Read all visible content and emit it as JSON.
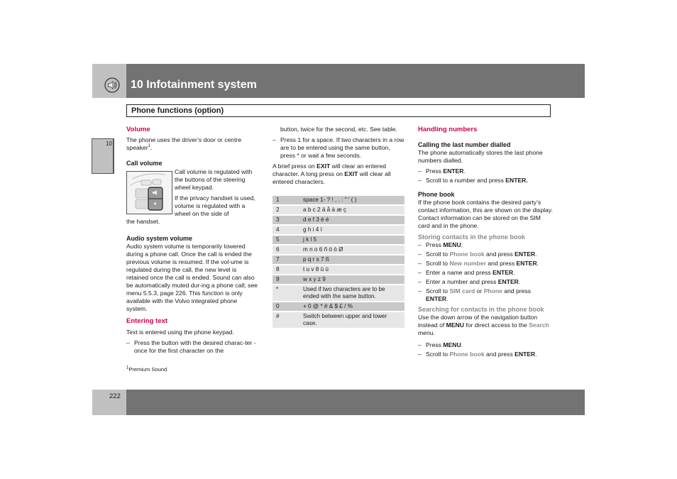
{
  "header": {
    "chapter_title": "10 Infotainment system",
    "chapter_icon": "speaker-icon",
    "section_title": "Phone functions (option)",
    "side_tab": "10"
  },
  "col1": {
    "volume_heading": "Volume",
    "volume_text": "The phone uses the driver’s door or centre speaker",
    "volume_footnote_ref": "1",
    "call_volume_heading": "Call volume",
    "call_volume_text1": "Call volume is regulated with the buttons of the steering wheel keypad.",
    "call_volume_text2a": "If the privacy handset is used, volume is regulated with a wheel on the side of",
    "call_volume_text2b": "the handset.",
    "keypad_image": "steering-wheel-keypad-illustration",
    "audio_heading": "Audio system volume",
    "audio_text": "Audio system volume is temporarily lowered during a phone call. Once the call is ended the previous volume is resumed. If the vol-ume is regulated during the call, the new level is retained once the call is ended. Sound can also be automatically muted dur-ing a phone call; see menu 5.5.3, page 226. This function is only available with the Volvo integrated phone system.",
    "entering_heading": "Entering text",
    "entering_text": "Text is entered using the phone keypad.",
    "entering_step1a": "Press the button with the desired charac-ter - once for the first character on the",
    "footnote_num": "1",
    "footnote_text": "Premium Sound"
  },
  "col2": {
    "step1b": "button, twice for the second, etc. See table.",
    "step2": "Press 1 for a space. If two characters in a row are to be entered using the same button, press * or wait a few seconds.",
    "exit_text_pre": "A brief press on ",
    "exit_bold1": "EXIT",
    "exit_text_mid": " will clear an entered character. A long press on ",
    "exit_bold2": "EXIT",
    "exit_text_post": " will clear all entered characters.",
    "keytable": [
      {
        "key": "1",
        "chars": "space 1- ? ! , . : \" ' ( )"
      },
      {
        "key": "2",
        "chars": "a b c 2 ä å à æ ç"
      },
      {
        "key": "3",
        "chars": "d e f 3 è é"
      },
      {
        "key": "4",
        "chars": "g h i 4 ì"
      },
      {
        "key": "5",
        "chars": "j k l 5"
      },
      {
        "key": "6",
        "chars": "m n o 6 ñ ö ò Ø"
      },
      {
        "key": "7",
        "chars": "p q r s 7 ß"
      },
      {
        "key": "8",
        "chars": "t u v 8 ü ù"
      },
      {
        "key": "9",
        "chars": "w x y z 9"
      },
      {
        "key": "*",
        "chars": "Used if two characters are to be ended with the same button."
      },
      {
        "key": "0",
        "chars": "+ 0 @ * # & $ £ / %"
      },
      {
        "key": "#",
        "chars": "Switch between upper and lower case."
      }
    ]
  },
  "col3": {
    "handling_heading": "Handling numbers",
    "last_heading": "Calling the last number dialled",
    "last_text": "The phone automatically stores the last phone numbers dialled.",
    "press": "Press ",
    "enter": "ENTER",
    "menu": "MENU",
    "scroll_to": "Scroll to ",
    "and_press": " and press ",
    "last_step2_pre": "Scroll to a number and press ",
    "phonebook_heading": "Phone book",
    "phonebook_text": "If the phone book contains the desired party’s contact information, this are shown on the display. Contact information can be stored on the SIM card and in the phone.",
    "storing_heading": "Storing contacts in the phone book",
    "term_phone_book": "Phone book",
    "term_new_number": "New number",
    "enter_name_pre": "Enter a name and press ",
    "enter_number_pre": "Enter a number and press ",
    "term_sim_card": "SIM card",
    "or": " or ",
    "term_phone": "Phone",
    "searching_heading": "Searching for contacts in the phone book",
    "search_text_pre": "Use the down arrow of the navigation button instead of ",
    "search_text_mid": " for direct access to the ",
    "term_search": "Search",
    "search_text_post": " menu."
  },
  "footer": {
    "page_number": "222"
  }
}
